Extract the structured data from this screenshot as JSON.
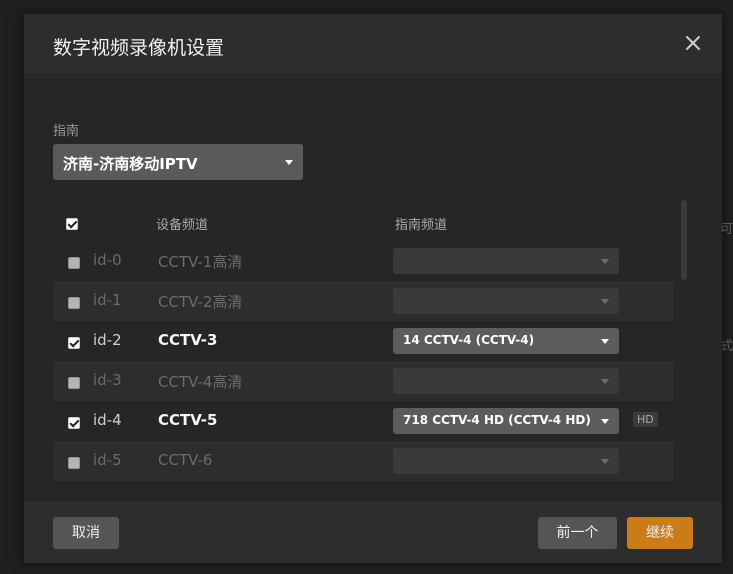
{
  "backdrop": {
    "edge_text_1": "可",
    "edge_text_2": "式"
  },
  "modal": {
    "title": "数字视频录像机设置",
    "close_icon": "close-icon"
  },
  "guide": {
    "label": "指南",
    "selected": "济南-济南移动IPTV"
  },
  "table": {
    "headers": {
      "device_channel": "设备频道",
      "guide_channel": "指南频道"
    },
    "rows": [
      {
        "id": "id-0",
        "name": "CCTV-1高清",
        "checked": false,
        "guide_channel": "",
        "badge": ""
      },
      {
        "id": "id-1",
        "name": "CCTV-2高清",
        "checked": false,
        "guide_channel": "",
        "badge": ""
      },
      {
        "id": "id-2",
        "name": "CCTV-3",
        "checked": true,
        "guide_channel": "14 CCTV-4 (CCTV-4)",
        "badge": ""
      },
      {
        "id": "id-3",
        "name": "CCTV-4高清",
        "checked": false,
        "guide_channel": "",
        "badge": ""
      },
      {
        "id": "id-4",
        "name": "CCTV-5",
        "checked": true,
        "guide_channel": "718 CCTV-4 HD (CCTV-4 HD)",
        "badge": "HD"
      },
      {
        "id": "id-5",
        "name": "CCTV-6",
        "checked": false,
        "guide_channel": "",
        "badge": ""
      }
    ]
  },
  "footer": {
    "cancel": "取消",
    "previous": "前一个",
    "continue": "继续"
  },
  "colors": {
    "accent": "#cc7b19"
  }
}
